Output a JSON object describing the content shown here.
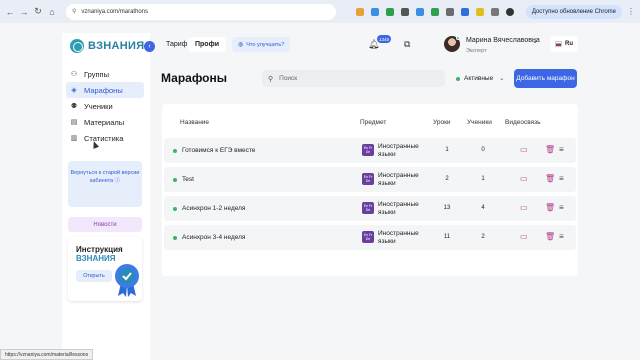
{
  "browser": {
    "url": "vznaniya.com/marathons",
    "update_label": "Доступно обновление Chrome",
    "status_url": "https://vznaniya.com/material/lessons"
  },
  "sidebar": {
    "logo_text": "ВЗНАНИЯ",
    "items": [
      {
        "label": "Группы",
        "icon": "users-icon"
      },
      {
        "label": "Марафоны",
        "icon": "layers-icon",
        "active": true
      },
      {
        "label": "Ученики",
        "icon": "students-icon"
      },
      {
        "label": "Материалы",
        "icon": "document-icon"
      },
      {
        "label": "Статистика",
        "icon": "chart-icon"
      }
    ],
    "old_version_text": "Вернуться к старой версии кабинета",
    "news_label": "Новости",
    "instruction": {
      "title": "Инструкция",
      "brand": "ВЗНАНИЯ",
      "open_label": "Открыть"
    }
  },
  "header": {
    "tarif_label": "Тариф",
    "tarif_value": "Профи",
    "improve_label": "Что улучшить?",
    "notification_count": "1348",
    "user_name": "Марина Вячеславовна",
    "user_role": "Эксперт",
    "lang": "Ru"
  },
  "main": {
    "title": "Марафоны",
    "search_placeholder": "Поиск",
    "status_filter": "Активные",
    "add_button": "Добавить марафон",
    "columns": {
      "name": "Название",
      "subject": "Предмет",
      "lessons": "Уроки",
      "students": "Ученики",
      "video": "Видеосвязь"
    },
    "subject_icon_text": "En Fr De",
    "rows": [
      {
        "name": "Готовимся к ЕГЭ вместе",
        "subject": "Иностранные языки",
        "lessons": "1",
        "students": "0"
      },
      {
        "name": "Test",
        "subject": "Иностранные языки",
        "lessons": "2",
        "students": "1"
      },
      {
        "name": "Асинхрон 1-2 неделя",
        "subject": "Иностранные языки",
        "lessons": "13",
        "students": "4"
      },
      {
        "name": "Асинхрон 3-4 неделя",
        "subject": "Иностранные языки",
        "lessons": "11",
        "students": "2"
      }
    ]
  },
  "colors": {
    "accent": "#3d66e4",
    "active_dot": "#3cb36a",
    "action_icon": "#b03a8a"
  }
}
